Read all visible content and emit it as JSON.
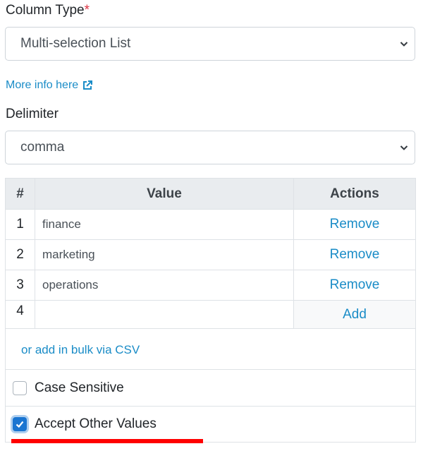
{
  "column_type": {
    "label": "Column Type",
    "required_mark": "*",
    "selected": "Multi-selection List"
  },
  "more_info": {
    "label": "More info here",
    "icon": "external-link-icon"
  },
  "delimiter": {
    "label": "Delimiter",
    "selected": "comma"
  },
  "table": {
    "headers": {
      "num": "#",
      "value": "Value",
      "actions": "Actions"
    },
    "rows": [
      {
        "num": "1",
        "value": "finance",
        "action": "Remove"
      },
      {
        "num": "2",
        "value": "marketing",
        "action": "Remove"
      },
      {
        "num": "3",
        "value": "operations",
        "action": "Remove"
      }
    ],
    "new_row": {
      "num": "4",
      "value": "",
      "action": "Add"
    }
  },
  "bulk_link": "or add in bulk via CSV",
  "options": {
    "case_sensitive": {
      "label": "Case Sensitive",
      "checked": false
    },
    "accept_other_values": {
      "label": "Accept Other Values",
      "checked": true
    }
  },
  "colors": {
    "link": "#1a8cc7",
    "required": "#dc3545",
    "highlight": "#ff0000",
    "checkbox": "#1a75d1"
  }
}
